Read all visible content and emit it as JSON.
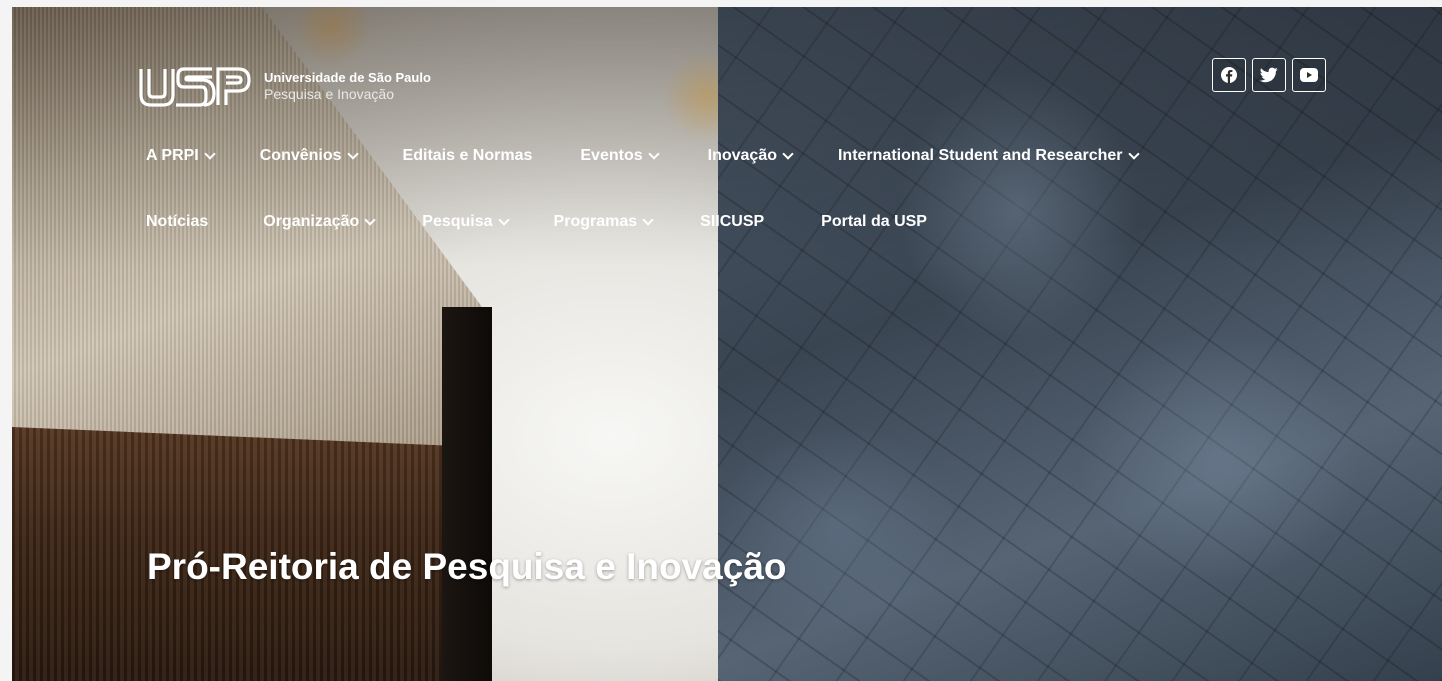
{
  "header": {
    "logo_mark": "USP",
    "org_name": "Universidade de São Paulo",
    "org_subtitle": "Pesquisa e Inovação",
    "social": [
      {
        "icon": "facebook-icon"
      },
      {
        "icon": "twitter-icon"
      },
      {
        "icon": "youtube-icon"
      }
    ]
  },
  "nav": {
    "row1": [
      {
        "label": "A PRPI",
        "has_dropdown": true
      },
      {
        "label": "Convênios",
        "has_dropdown": true
      },
      {
        "label": "Editais e Normas",
        "has_dropdown": false
      },
      {
        "label": "Eventos",
        "has_dropdown": true
      },
      {
        "label": "Inovação",
        "has_dropdown": true
      },
      {
        "label": "International Student and Researcher",
        "has_dropdown": true
      }
    ],
    "row2": [
      {
        "label": "Notícias",
        "has_dropdown": false
      },
      {
        "label": "Organização",
        "has_dropdown": true
      },
      {
        "label": "Pesquisa",
        "has_dropdown": true
      },
      {
        "label": "Programas",
        "has_dropdown": true
      },
      {
        "label": "SIICUSP",
        "has_dropdown": false
      },
      {
        "label": "Portal da USP",
        "has_dropdown": false
      }
    ]
  },
  "hero": {
    "title": "Pró-Reitoria de Pesquisa e Inovação"
  },
  "colors": {
    "text": "#ffffff",
    "page_bg": "#f4f4f4"
  }
}
